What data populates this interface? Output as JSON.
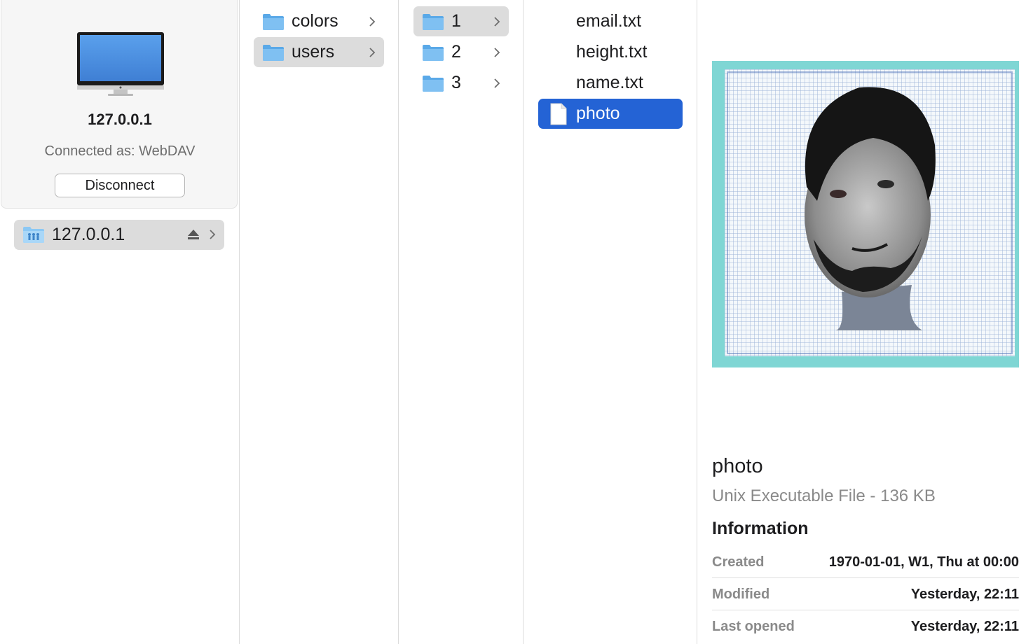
{
  "server": {
    "name": "127.0.0.1",
    "connected_as": "Connected as: WebDAV",
    "disconnect_label": "Disconnect",
    "monitor_icon": "imac-monitor-icon"
  },
  "sidebar": {
    "mount": {
      "label": "127.0.0.1",
      "icon": "network-share-icon",
      "eject_icon": "eject-icon"
    }
  },
  "column1": {
    "items": [
      {
        "label": "colors",
        "type": "folder",
        "selected": false
      },
      {
        "label": "users",
        "type": "folder",
        "selected": true
      }
    ]
  },
  "column2": {
    "items": [
      {
        "label": "1",
        "type": "folder",
        "selected": true
      },
      {
        "label": "2",
        "type": "folder",
        "selected": false
      },
      {
        "label": "3",
        "type": "folder",
        "selected": false
      }
    ]
  },
  "column3": {
    "items": [
      {
        "label": "email.txt",
        "type": "text",
        "selected": false
      },
      {
        "label": "height.txt",
        "type": "text",
        "selected": false
      },
      {
        "label": "name.txt",
        "type": "text",
        "selected": false
      },
      {
        "label": "photo",
        "type": "document",
        "selected": true
      }
    ]
  },
  "preview": {
    "title": "photo",
    "kind": "Unix Executable File - 136 KB",
    "info_heading": "Information",
    "info": [
      {
        "key": "Created",
        "value": "1970-01-01, W1, Thu at 00:00"
      },
      {
        "key": "Modified",
        "value": "Yesterday, 22:11"
      },
      {
        "key": "Last opened",
        "value": "Yesterday, 22:11"
      }
    ]
  },
  "colors": {
    "selection_blue": "#2463d5",
    "selection_grey": "#dcdcdc",
    "folder_blue": "#6ab4ef",
    "thumb_border": "#7fd6d4"
  }
}
